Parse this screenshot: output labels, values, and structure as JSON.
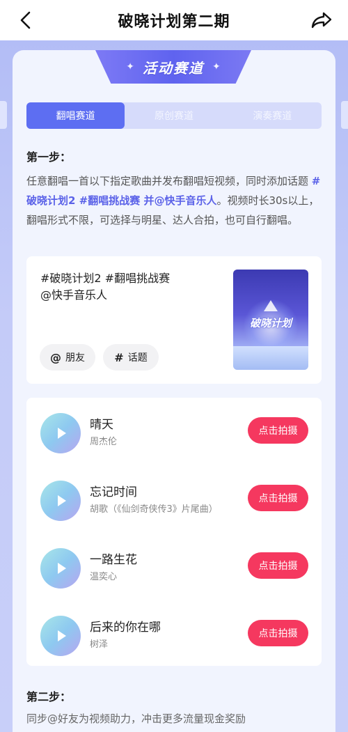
{
  "nav": {
    "title": "破晓计划第二期"
  },
  "header": {
    "badge_text": "活动赛道",
    "star_glyph": "✦"
  },
  "tabs": [
    {
      "label": "翻唱赛道",
      "active": true
    },
    {
      "label": "原创赛道",
      "active": false
    },
    {
      "label": "演奏赛道",
      "active": false
    }
  ],
  "step1": {
    "title": "第一步：",
    "desc_part1": "任意翻唱一首以下指定歌曲并发布翻唱短视频，同时添加话题 ",
    "desc_highlight": "#破晓计划2 #翻唱挑战赛 并@快手音乐人",
    "desc_part2": "。视频时长30s以上，翻唱形式不限，可选择与明星、达人合拍，也可自行翻唱。"
  },
  "share": {
    "line1": "#破晓计划2 #翻唱挑战赛",
    "line2": "@快手音乐人",
    "friend_button": {
      "symbol": "@",
      "label": "朋友"
    },
    "topic_button": {
      "symbol": "#",
      "label": "话题"
    },
    "thumbnail_text": "破晓计划"
  },
  "songs": [
    {
      "title": "晴天",
      "artist": "周杰伦",
      "button": "点击拍摄"
    },
    {
      "title": "忘记时间",
      "artist": "胡歌（《仙剑奇侠传3》片尾曲）",
      "button": "点击拍摄"
    },
    {
      "title": "一路生花",
      "artist": "温奕心",
      "button": "点击拍摄"
    },
    {
      "title": "后来的你在哪",
      "artist": "树泽",
      "button": "点击拍摄"
    }
  ],
  "step2": {
    "title": "第二步：",
    "desc": "同步@好友为视频助力，冲击更多流量现金奖励"
  },
  "colors": {
    "accent": "#5d6ef2",
    "button": "#f5385f",
    "background": "#b9c2f7"
  }
}
